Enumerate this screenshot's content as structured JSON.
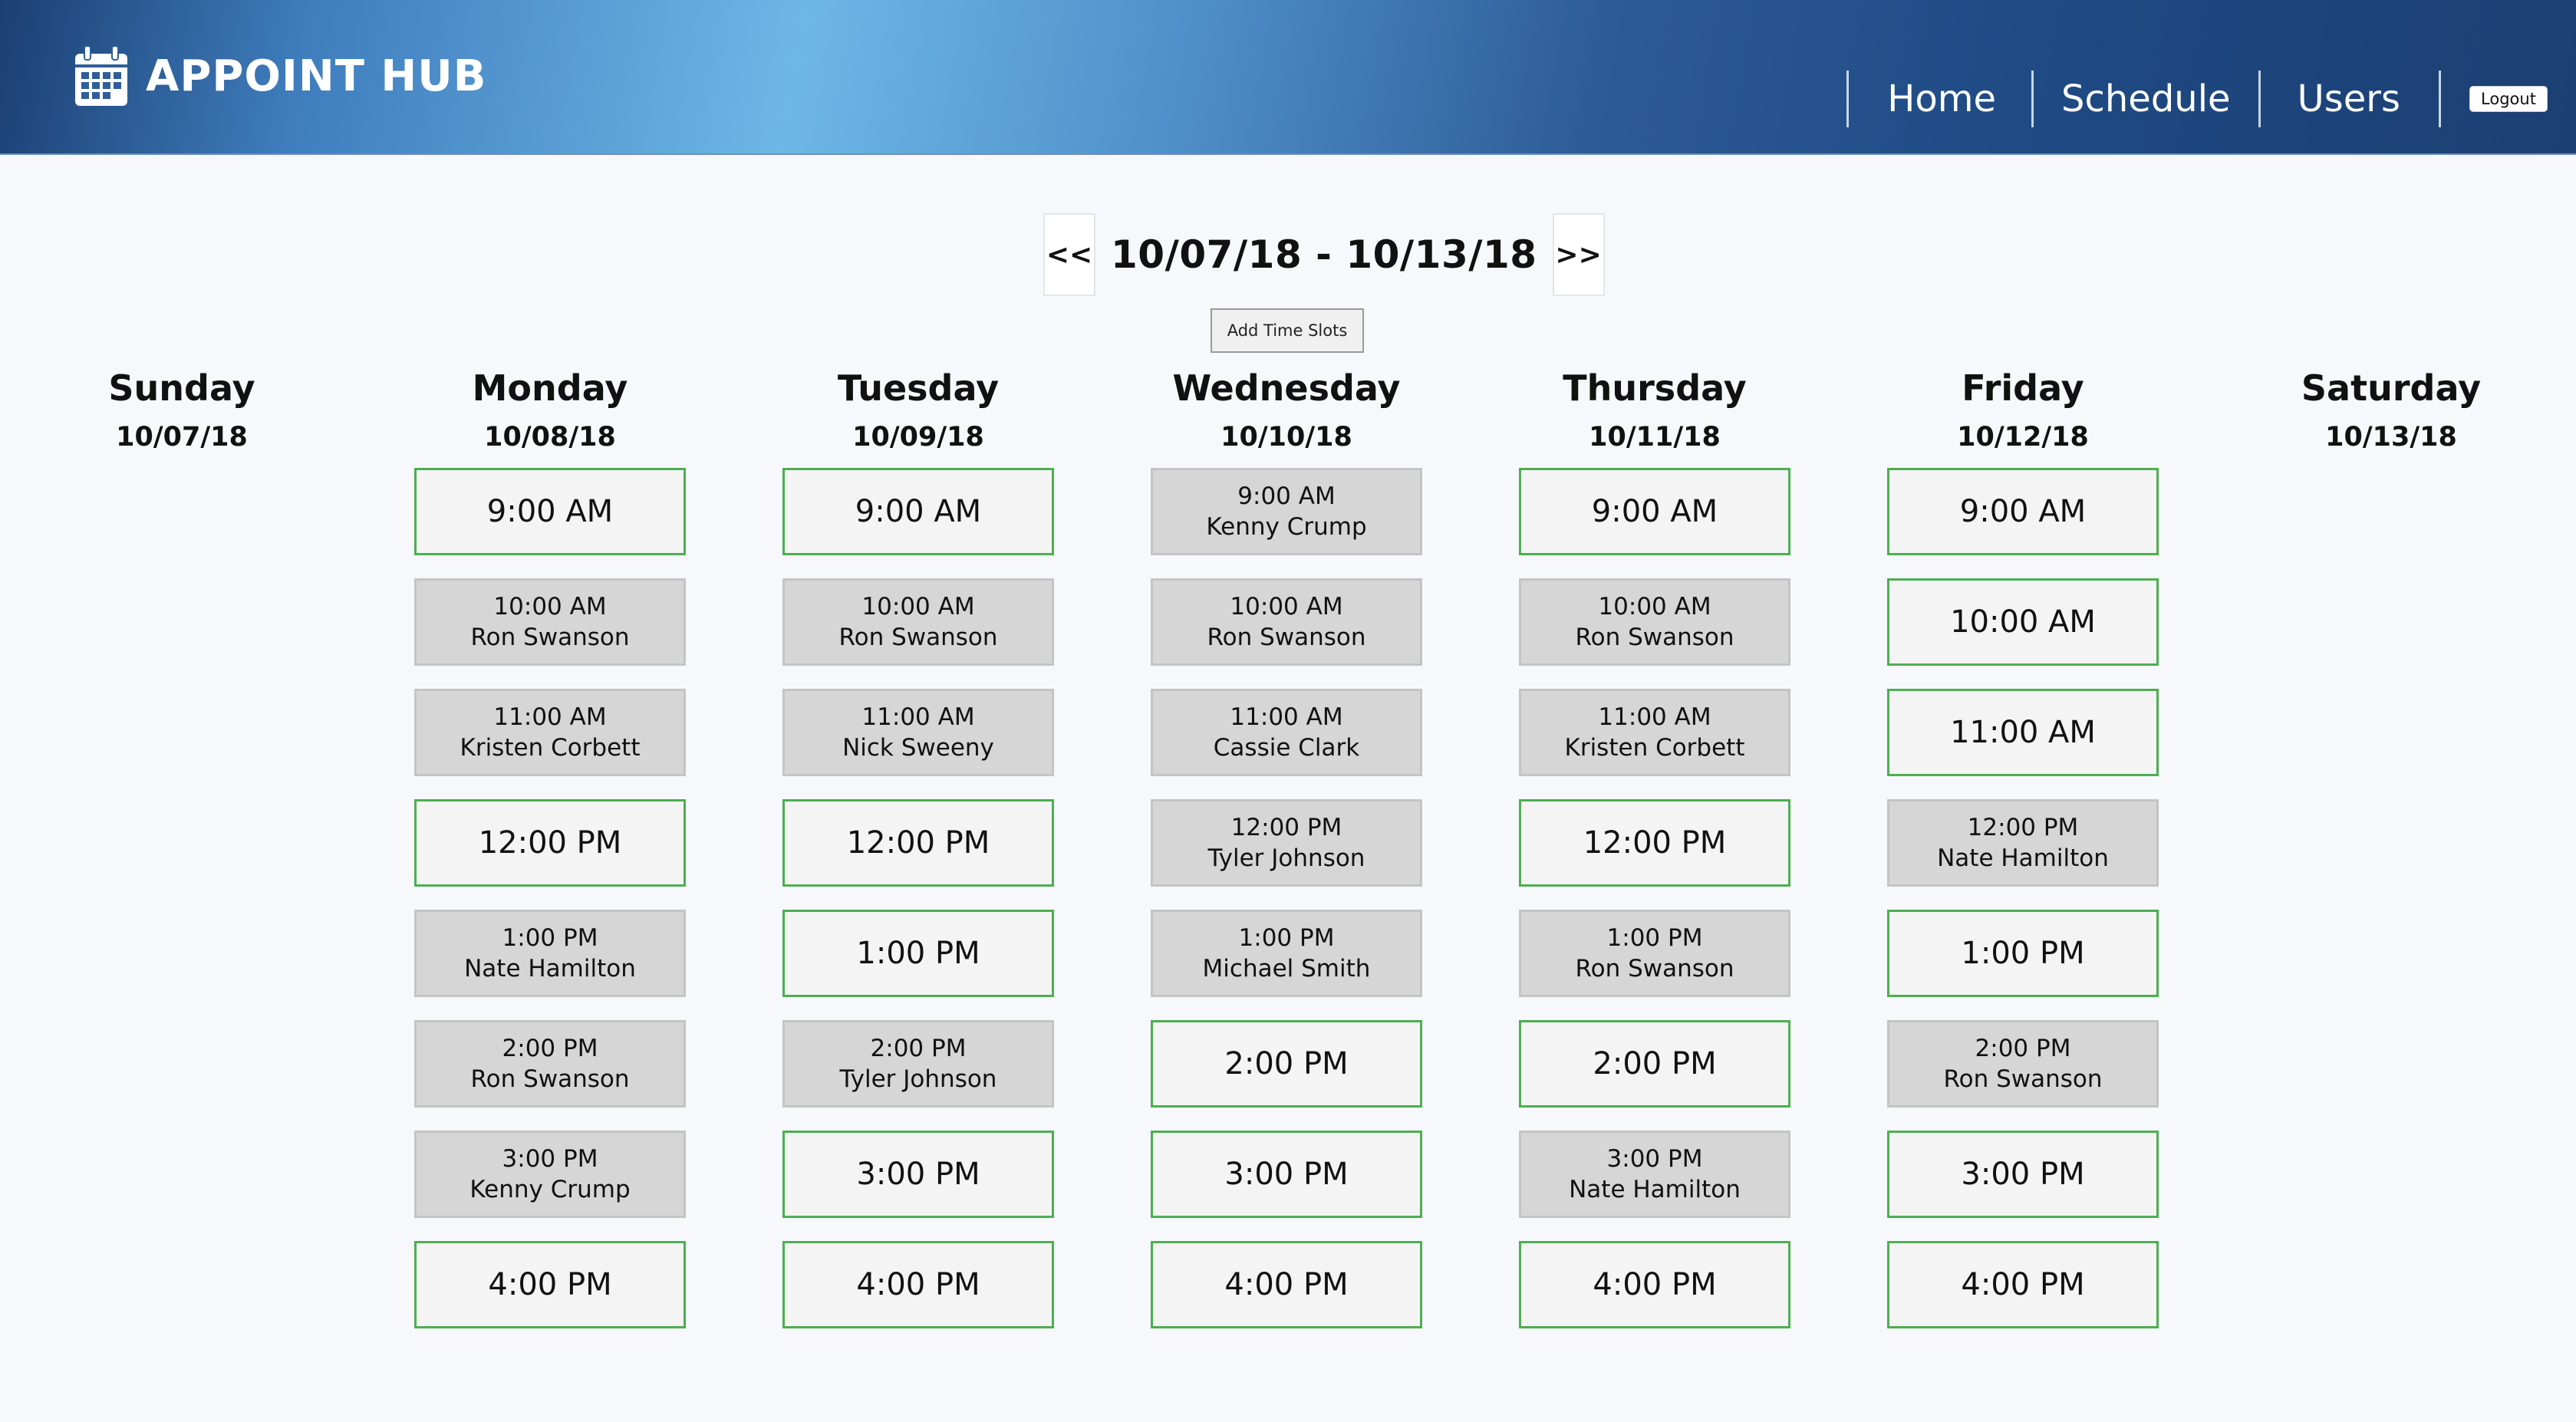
{
  "app": {
    "title": "APPOINT HUB",
    "logo_icon": "calendar-icon"
  },
  "nav": {
    "links": [
      "Home",
      "Schedule",
      "Users"
    ],
    "logout_label": "Logout"
  },
  "week": {
    "prev_label": "<<",
    "range": "10/07/18 - 10/13/18",
    "next_label": ">>",
    "add_slots_label": "Add Time Slots"
  },
  "colors": {
    "open_border": "#4caf50",
    "booked_fill": "#d6d6d6",
    "header_start": "#1b3f72",
    "header_mid": "#6db7e6"
  },
  "days": [
    {
      "name": "Sunday",
      "date": "10/07/18",
      "slots": []
    },
    {
      "name": "Monday",
      "date": "10/08/18",
      "slots": [
        {
          "time": "9:00 AM",
          "name": ""
        },
        {
          "time": "10:00 AM",
          "name": "Ron Swanson"
        },
        {
          "time": "11:00 AM",
          "name": "Kristen Corbett"
        },
        {
          "time": "12:00 PM",
          "name": ""
        },
        {
          "time": "1:00 PM",
          "name": "Nate Hamilton"
        },
        {
          "time": "2:00 PM",
          "name": "Ron Swanson"
        },
        {
          "time": "3:00 PM",
          "name": "Kenny Crump"
        },
        {
          "time": "4:00 PM",
          "name": ""
        }
      ]
    },
    {
      "name": "Tuesday",
      "date": "10/09/18",
      "slots": [
        {
          "time": "9:00 AM",
          "name": ""
        },
        {
          "time": "10:00 AM",
          "name": "Ron Swanson"
        },
        {
          "time": "11:00 AM",
          "name": "Nick Sweeny"
        },
        {
          "time": "12:00 PM",
          "name": ""
        },
        {
          "time": "1:00 PM",
          "name": ""
        },
        {
          "time": "2:00 PM",
          "name": "Tyler Johnson"
        },
        {
          "time": "3:00 PM",
          "name": ""
        },
        {
          "time": "4:00 PM",
          "name": ""
        }
      ]
    },
    {
      "name": "Wednesday",
      "date": "10/10/18",
      "slots": [
        {
          "time": "9:00 AM",
          "name": "Kenny Crump"
        },
        {
          "time": "10:00 AM",
          "name": "Ron Swanson"
        },
        {
          "time": "11:00 AM",
          "name": "Cassie Clark"
        },
        {
          "time": "12:00 PM",
          "name": "Tyler Johnson"
        },
        {
          "time": "1:00 PM",
          "name": "Michael Smith"
        },
        {
          "time": "2:00 PM",
          "name": ""
        },
        {
          "time": "3:00 PM",
          "name": ""
        },
        {
          "time": "4:00 PM",
          "name": ""
        }
      ]
    },
    {
      "name": "Thursday",
      "date": "10/11/18",
      "slots": [
        {
          "time": "9:00 AM",
          "name": ""
        },
        {
          "time": "10:00 AM",
          "name": "Ron Swanson"
        },
        {
          "time": "11:00 AM",
          "name": "Kristen Corbett"
        },
        {
          "time": "12:00 PM",
          "name": ""
        },
        {
          "time": "1:00 PM",
          "name": "Ron Swanson"
        },
        {
          "time": "2:00 PM",
          "name": ""
        },
        {
          "time": "3:00 PM",
          "name": "Nate Hamilton"
        },
        {
          "time": "4:00 PM",
          "name": ""
        }
      ]
    },
    {
      "name": "Friday",
      "date": "10/12/18",
      "slots": [
        {
          "time": "9:00 AM",
          "name": ""
        },
        {
          "time": "10:00 AM",
          "name": ""
        },
        {
          "time": "11:00 AM",
          "name": ""
        },
        {
          "time": "12:00 PM",
          "name": "Nate Hamilton"
        },
        {
          "time": "1:00 PM",
          "name": ""
        },
        {
          "time": "2:00 PM",
          "name": "Ron Swanson"
        },
        {
          "time": "3:00 PM",
          "name": ""
        },
        {
          "time": "4:00 PM",
          "name": ""
        }
      ]
    },
    {
      "name": "Saturday",
      "date": "10/13/18",
      "slots": []
    }
  ]
}
